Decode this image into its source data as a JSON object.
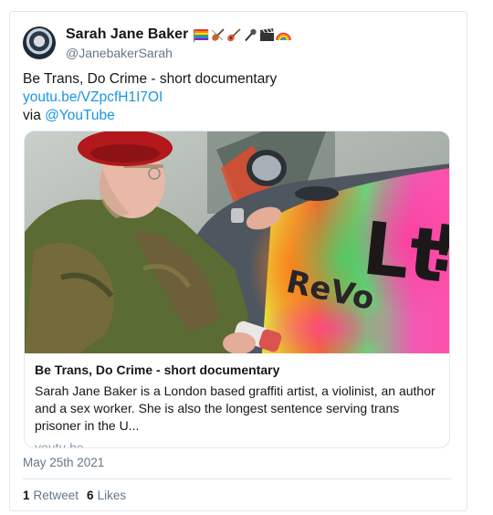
{
  "author": {
    "display_name": "Sarah Jane Baker",
    "handle": "@JanebakerSarah",
    "emojis": [
      "rainbow-flag",
      "violin",
      "guitar",
      "microphone",
      "clapper-board",
      "rainbow"
    ]
  },
  "tweet": {
    "line1": "Be Trans, Do Crime -  short documentary",
    "link": "youtu.be/VZpcfH1I7OI",
    "via_prefix": "via ",
    "via_mention": "@YouTube"
  },
  "card": {
    "title": "Be Trans, Do Crime - short documentary",
    "description": "Sarah Jane Baker is a London based graffiti artist, a violinist, an author and a sex worker. She is also the longest sentence serving trans prisoner in the U...",
    "domain": "youtu.be",
    "image_text": "ReVolt!"
  },
  "meta": {
    "date": "May 25th 2021",
    "retweets_count": "1",
    "retweets_label": "Retweet",
    "likes_count": "6",
    "likes_label": "Likes"
  },
  "colors": {
    "link": "#1b95e0",
    "secondary_text": "#657786",
    "border": "#e1e8ed"
  }
}
